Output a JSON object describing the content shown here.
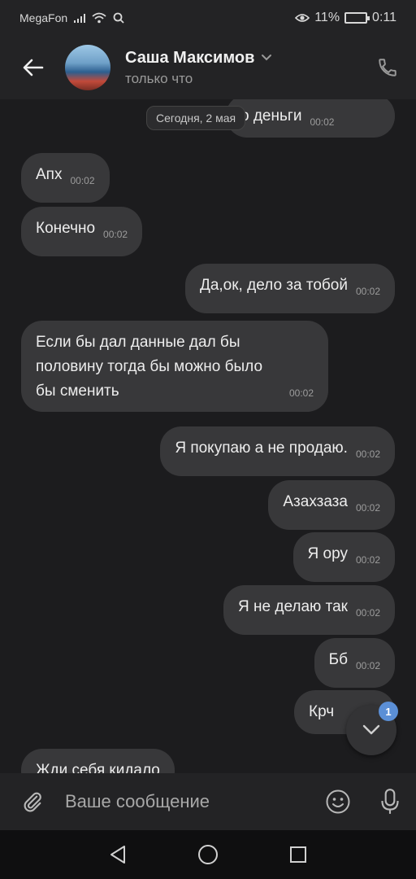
{
  "statusbar": {
    "carrier": "MegaFon",
    "battery": "11%",
    "time": "0:11"
  },
  "header": {
    "name": "Саша Максимов",
    "status": "только что"
  },
  "chat": {
    "date_chip": "Сегодня, 2 мая",
    "messages": [
      {
        "text": "о деньги",
        "time": "00:02",
        "side": "out"
      },
      {
        "text": "Апх",
        "time": "00:02",
        "side": "in"
      },
      {
        "text": "Конечно",
        "time": "00:02",
        "side": "in"
      },
      {
        "text": "Да,ок, дело за тобой",
        "time": "00:02",
        "side": "out"
      },
      {
        "lines": [
          "Если бы дал данные дал бы",
          "половину тогда бы можно было",
          "бы сменить"
        ],
        "time": "00:02",
        "side": "in"
      },
      {
        "text": "Я покупаю а не продаю.",
        "time": "00:02",
        "side": "out"
      },
      {
        "text": "Азахзаза",
        "time": "00:02",
        "side": "out"
      },
      {
        "text": "Я ору",
        "time": "00:02",
        "side": "out"
      },
      {
        "text": "Я не делаю так",
        "time": "00:02",
        "side": "out"
      },
      {
        "text": "Бб",
        "time": "00:02",
        "side": "out"
      },
      {
        "text": "Крч",
        "time": "",
        "side": "out"
      },
      {
        "text": "Жди себя кидало",
        "time": "",
        "side": "in"
      }
    ],
    "unread_badge": "1"
  },
  "input": {
    "placeholder": "Ваше сообщение"
  },
  "colors": {
    "background": "#1c1c1e",
    "bubble": "#38383a",
    "header": "#232325",
    "badge": "#5b8fd6"
  },
  "icons": [
    "back-arrow-icon",
    "chevron-down-icon",
    "phone-icon",
    "paperclip-icon",
    "emoji-icon",
    "microphone-icon",
    "nav-back-icon",
    "nav-home-icon",
    "nav-recents-icon",
    "scroll-down-icon"
  ]
}
